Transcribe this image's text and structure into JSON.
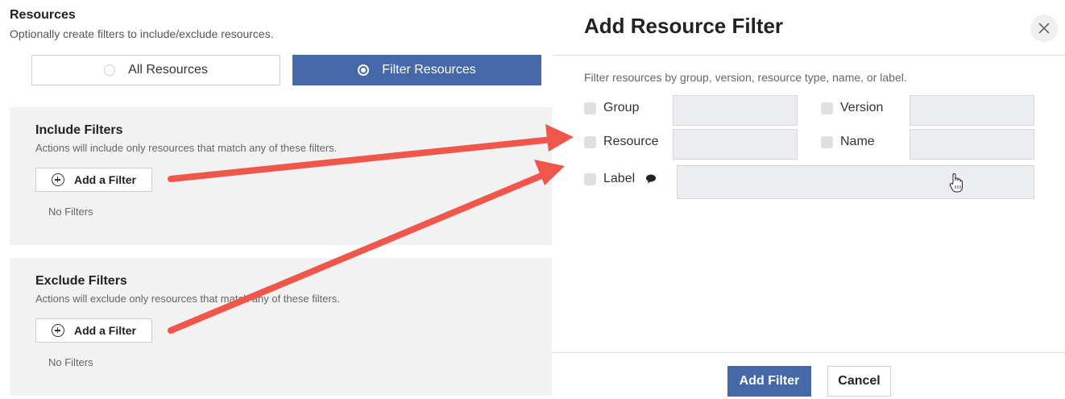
{
  "resources": {
    "title": "Resources",
    "subtitle": "Optionally create filters to include/exclude resources.",
    "options": {
      "all": "All Resources",
      "filter": "Filter Resources",
      "selected": "Filter Resources"
    }
  },
  "include": {
    "title": "Include Filters",
    "description": "Actions will include only resources that match any of these filters.",
    "add_label": "Add a Filter",
    "empty": "No Filters"
  },
  "exclude": {
    "title": "Exclude Filters",
    "description": "Actions will exclude only resources that match any of these filters.",
    "add_label": "Add a Filter",
    "empty": "No Filters"
  },
  "dialog": {
    "title": "Add Resource Filter",
    "description": "Filter resources by group, version, resource type, name, or label.",
    "fields": {
      "group": {
        "label": "Group",
        "value": ""
      },
      "version": {
        "label": "Version",
        "value": ""
      },
      "resource": {
        "label": "Resource",
        "value": ""
      },
      "name": {
        "label": "Name",
        "value": ""
      },
      "label": {
        "label": "Label",
        "value": ""
      }
    },
    "add_button": "Add Filter",
    "cancel_button": "Cancel"
  },
  "colors": {
    "primary": "#4468a8",
    "annotation_arrow": "#f0564a",
    "panel_bg": "#f2f2f2"
  },
  "icons": [
    "plus-circle-icon",
    "close-icon",
    "info-bubble-icon",
    "hand-cursor-icon",
    "annotation-arrow"
  ]
}
